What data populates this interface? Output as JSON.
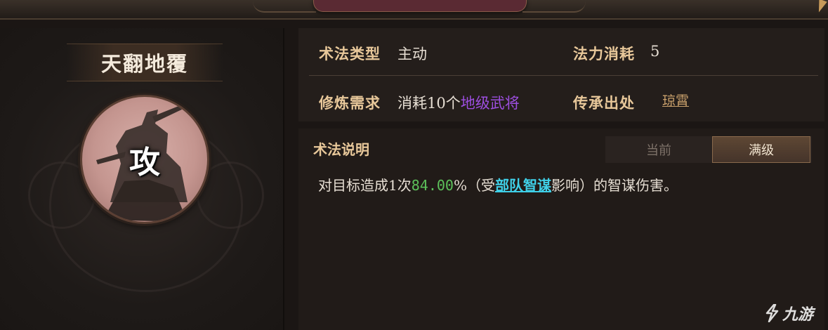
{
  "skill": {
    "name": "天翻地覆",
    "icon_char": "攻",
    "icon": "warrior-attack-icon"
  },
  "info": {
    "type_label": "术法类型",
    "type_value": "主动",
    "cost_label": "法力消耗",
    "cost_value": "5",
    "requirement_label": "修炼需求",
    "requirement_prefix": "消耗10个",
    "requirement_highlight": "地级武将",
    "source_label": "传承出处",
    "source_value": "琼霄"
  },
  "description": {
    "title": "术法说明",
    "tabs": [
      "当前",
      "满级"
    ],
    "active_tab": "满级",
    "text_prefix": "对目标造成1次",
    "percent": "84.00",
    "text_mid": "%（受",
    "attribute": "部队智谋",
    "text_suffix": "影响）的智谋伤害。"
  },
  "watermark": {
    "text": "九游"
  },
  "colors": {
    "label": "#e8c89a",
    "highlight_purple": "#9d4ee0",
    "percent_green": "#5cc05a",
    "attribute_cyan": "#3fd0e8"
  }
}
